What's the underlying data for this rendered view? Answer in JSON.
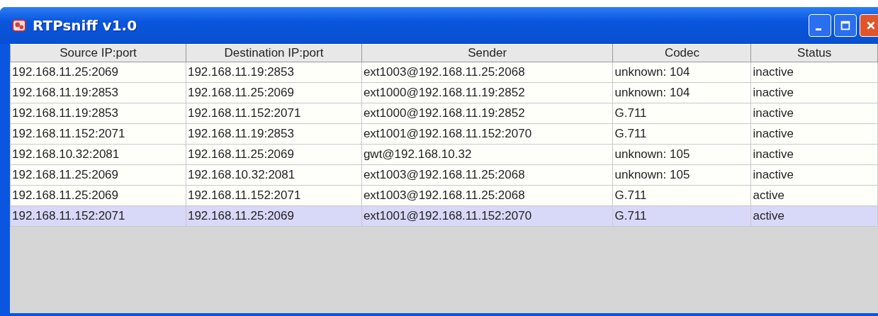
{
  "window": {
    "title": "RTPsniff v1.0"
  },
  "table": {
    "columns": [
      "Source IP:port",
      "Destination IP:port",
      "Sender",
      "Codec",
      "Status"
    ],
    "rows": [
      {
        "cells": [
          "192.168.11.25:2069",
          "192.168.11.19:2853",
          "ext1003@192.168.11.25:2068",
          "unknown: 104",
          "inactive"
        ],
        "selected": false
      },
      {
        "cells": [
          "192.168.11.19:2853",
          "192.168.11.25:2069",
          "ext1000@192.168.11.19:2852",
          "unknown: 104",
          "inactive"
        ],
        "selected": false
      },
      {
        "cells": [
          "192.168.11.19:2853",
          "192.168.11.152:2071",
          "ext1000@192.168.11.19:2852",
          "G.711",
          "inactive"
        ],
        "selected": false
      },
      {
        "cells": [
          "192.168.11.152:2071",
          "192.168.11.19:2853",
          "ext1001@192.168.11.152:2070",
          "G.711",
          "inactive"
        ],
        "selected": false
      },
      {
        "cells": [
          "192.168.10.32:2081",
          "192.168.11.25:2069",
          "gwt@192.168.10.32",
          "unknown: 105",
          "inactive"
        ],
        "selected": false
      },
      {
        "cells": [
          "192.168.11.25:2069",
          "192.168.10.32:2081",
          "ext1003@192.168.11.25:2068",
          "unknown: 105",
          "inactive"
        ],
        "selected": false
      },
      {
        "cells": [
          "192.168.11.25:2069",
          "192.168.11.152:2071",
          "ext1003@192.168.11.25:2068",
          "G.711",
          "active"
        ],
        "selected": false
      },
      {
        "cells": [
          "192.168.11.152:2071",
          "192.168.11.25:2069",
          "ext1001@192.168.11.152:2070",
          "G.711",
          "active"
        ],
        "selected": true
      }
    ]
  }
}
